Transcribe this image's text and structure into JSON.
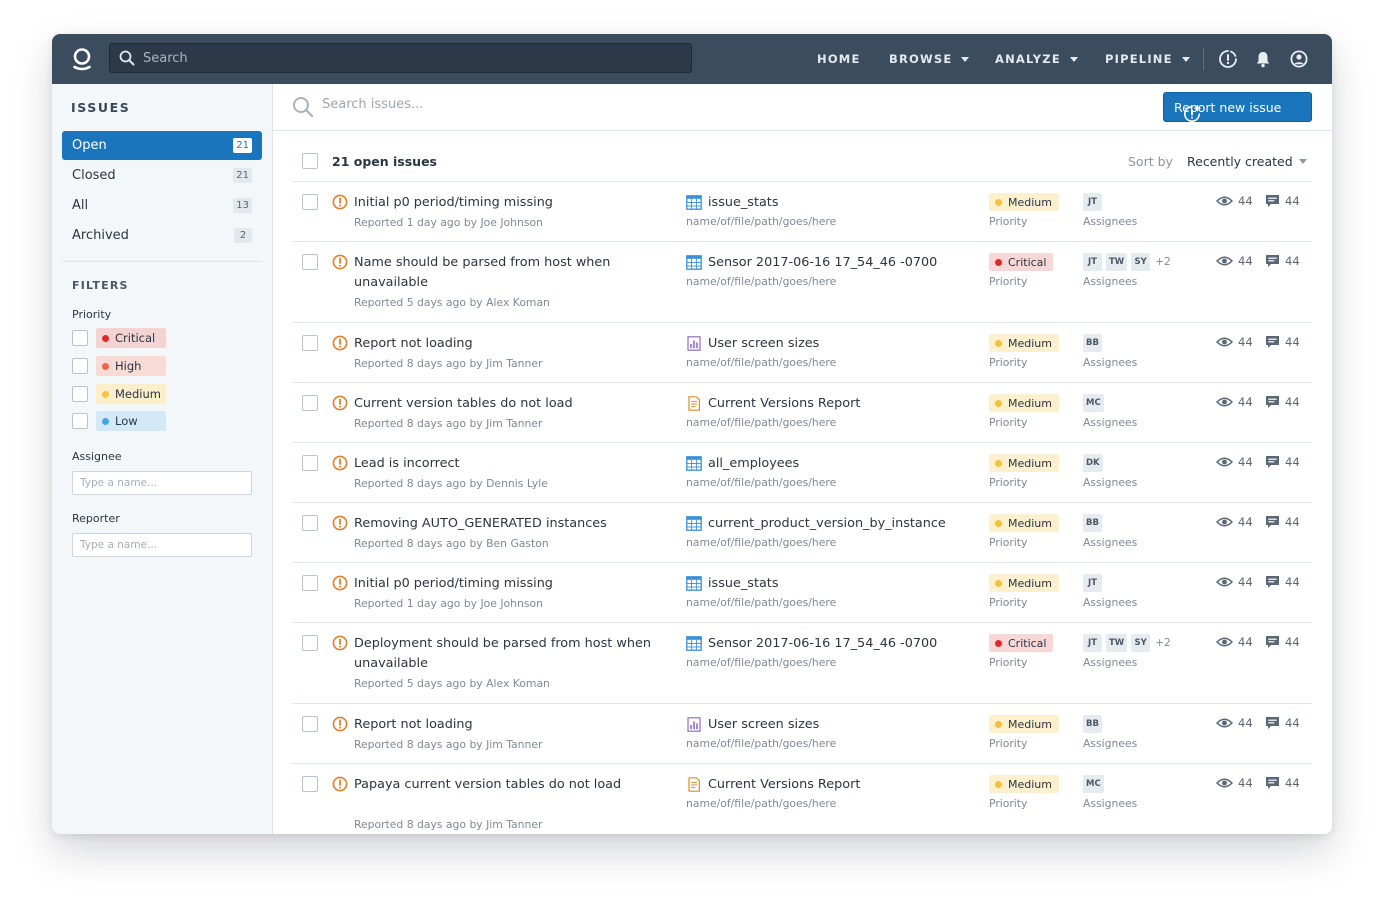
{
  "topbar": {
    "search_placeholder": "Search",
    "nav": [
      {
        "label": "HOME",
        "caret": false
      },
      {
        "label": "BROWSE",
        "caret": true
      },
      {
        "label": "ANALYZE",
        "caret": true
      },
      {
        "label": "PIPELINE",
        "caret": true
      }
    ],
    "icons": [
      "alert-icon",
      "bell-icon",
      "user-icon"
    ]
  },
  "sidebar": {
    "title": "ISSUES",
    "items": [
      {
        "label": "Open",
        "count": "21",
        "active": true
      },
      {
        "label": "Closed",
        "count": "21",
        "active": false
      },
      {
        "label": "All",
        "count": "13",
        "active": false
      },
      {
        "label": "Archived",
        "count": "2",
        "active": false
      }
    ],
    "filters_title": "FILTERS",
    "priority_label": "Priority",
    "priorities": [
      {
        "label": "Critical",
        "bg": "#f6d3d3",
        "dot": "#e0282e"
      },
      {
        "label": "High",
        "bg": "#f8dbd4",
        "dot": "#f0634a"
      },
      {
        "label": "Medium",
        "bg": "#fbeecb",
        "dot": "#f6c343"
      },
      {
        "label": "Low",
        "bg": "#d4e9f8",
        "dot": "#3ea6ea"
      }
    ],
    "assignee_label": "Assignee",
    "assignee_placeholder": "Type a name...",
    "reporter_label": "Reporter",
    "reporter_placeholder": "Type a name..."
  },
  "main": {
    "search_placeholder": "Search issues...",
    "report_button": "Report new issue",
    "count_label": "21 open issues",
    "sort_label": "Sort by",
    "sort_value": "Recently created",
    "priority_colors": {
      "Medium": {
        "bg": "#fdf0cf",
        "dot": "#f5c138"
      },
      "Critical": {
        "bg": "#f8d7d7",
        "dot": "#e0282e"
      }
    },
    "icon_colors": {
      "alert": "#e0802a",
      "table": "#3a8fd6",
      "chart": "#8f6fc4",
      "doc": "#d6922e"
    },
    "issues": [
      {
        "title": "Initial p0 period/timing missing",
        "reported": "Reported 1 day ago by Joe Johnson",
        "file_icon": "table",
        "file": "issue_stats",
        "path": "name/of/file/path/goes/here",
        "priority": "Medium",
        "priority_label": "Priority",
        "assignees": [
          "JT"
        ],
        "more": "",
        "assignees_label": "Assignees",
        "views": "44",
        "comments": "44"
      },
      {
        "title": "Name should be parsed from host when unavailable",
        "reported": "Reported 5 days ago by Alex Koman",
        "file_icon": "table",
        "file": "Sensor 2017-06-16 17_54_46 -0700",
        "path": "name/of/file/path/goes/here",
        "priority": "Critical",
        "priority_label": "Priority",
        "assignees": [
          "JT",
          "TW",
          "SY"
        ],
        "more": "+2",
        "assignees_label": "Assignees",
        "views": "44",
        "comments": "44"
      },
      {
        "title": "Report not loading",
        "reported": "Reported 8 days ago by Jim Tanner",
        "file_icon": "chart",
        "file": "User screen sizes",
        "path": "name/of/file/path/goes/here",
        "priority": "Medium",
        "priority_label": "Priority",
        "assignees": [
          "BB"
        ],
        "more": "",
        "assignees_label": "Assignees",
        "views": "44",
        "comments": "44"
      },
      {
        "title": "Current version tables do not load",
        "reported": "Reported 8 days ago by Jim Tanner",
        "file_icon": "doc",
        "file": "Current Versions Report",
        "path": "name/of/file/path/goes/here",
        "priority": "Medium",
        "priority_label": "Priority",
        "assignees": [
          "MC"
        ],
        "more": "",
        "assignees_label": "Assignees",
        "views": "44",
        "comments": "44"
      },
      {
        "title": "Lead is incorrect",
        "reported": "Reported 8 days ago by Dennis Lyle",
        "file_icon": "table",
        "file": "all_employees",
        "path": "name/of/file/path/goes/here",
        "priority": "Medium",
        "priority_label": "Priority",
        "assignees": [
          "DK"
        ],
        "more": "",
        "assignees_label": "Assignees",
        "views": "44",
        "comments": "44"
      },
      {
        "title": "Removing AUTO_GENERATED instances",
        "reported": "Reported 8 days ago by Ben Gaston",
        "file_icon": "table",
        "file": "current_product_version_by_instance",
        "path": "name/of/file/path/goes/here",
        "priority": "Medium",
        "priority_label": "Priority",
        "assignees": [
          "BB"
        ],
        "more": "",
        "assignees_label": "Assignees",
        "views": "44",
        "comments": "44"
      },
      {
        "title": "Initial p0 period/timing missing",
        "reported": "Reported 1 day ago by Joe Johnson",
        "file_icon": "table",
        "file": "issue_stats",
        "path": "name/of/file/path/goes/here",
        "priority": "Medium",
        "priority_label": "Priority",
        "assignees": [
          "JT"
        ],
        "more": "",
        "assignees_label": "Assignees",
        "views": "44",
        "comments": "44"
      },
      {
        "title": "Deployment should be parsed from host when unavailable",
        "reported": "Reported 5 days ago by Alex Koman",
        "file_icon": "table",
        "file": "Sensor 2017-06-16 17_54_46 -0700",
        "path": "name/of/file/path/goes/here",
        "priority": "Critical",
        "priority_label": "Priority",
        "assignees": [
          "JT",
          "TW",
          "SY"
        ],
        "more": "+2",
        "assignees_label": "Assignees",
        "views": "44",
        "comments": "44"
      },
      {
        "title": "Report not loading",
        "reported": "Reported 8 days ago by Jim Tanner",
        "file_icon": "chart",
        "file": "User screen sizes",
        "path": "name/of/file/path/goes/here",
        "priority": "Medium",
        "priority_label": "Priority",
        "assignees": [
          "BB"
        ],
        "more": "",
        "assignees_label": "Assignees",
        "views": "44",
        "comments": "44"
      },
      {
        "title": "Papaya current version tables do not load",
        "reported": "Reported 8 days ago by Jim Tanner",
        "file_icon": "doc",
        "file": "Current Versions Report",
        "path": "name/of/file/path/goes/here",
        "priority": "Medium",
        "priority_label": "Priority",
        "assignees": [
          "MC"
        ],
        "more": "",
        "assignees_label": "Assignees",
        "views": "44",
        "comments": "44"
      }
    ]
  }
}
